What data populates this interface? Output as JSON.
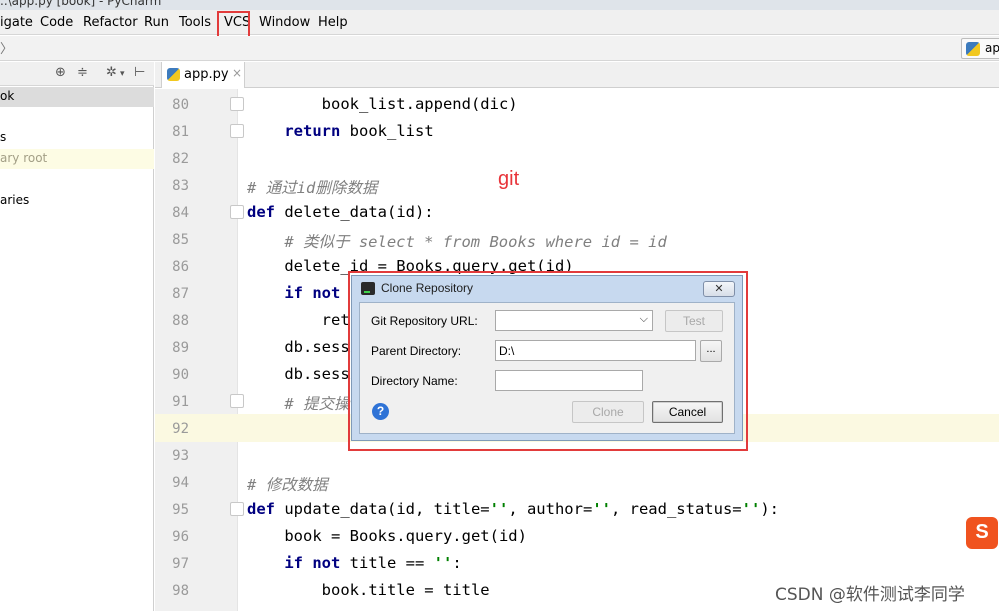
{
  "window": {
    "title": "..\\app.py [book] - PyCharm"
  },
  "menu": [
    "igate",
    "Code",
    "Refactor",
    "Run",
    "Tools",
    "VCS",
    "Window",
    "Help"
  ],
  "nav": {
    "run_config": "ap"
  },
  "project": {
    "rows": [
      "ok",
      "s",
      "ary root",
      "aries"
    ]
  },
  "editor": {
    "tab": "app.py",
    "lines": [
      {
        "n": "80",
        "text": "        book_list.append(dic)"
      },
      {
        "n": "81",
        "text": "    return book_list"
      },
      {
        "n": "82",
        "text": ""
      },
      {
        "n": "83",
        "text": "# 通过id删除数据"
      },
      {
        "n": "84",
        "text": "def delete_data(id):"
      },
      {
        "n": "85",
        "text": "    # 类似于 select * from Books where id = id"
      },
      {
        "n": "86",
        "text": "    delete_id = Books.query.get(id)"
      },
      {
        "n": "87",
        "text": "    if not"
      },
      {
        "n": "88",
        "text": "        ret"
      },
      {
        "n": "89",
        "text": "    db.sessi"
      },
      {
        "n": "90",
        "text": "    db.sessi"
      },
      {
        "n": "91",
        "text": "    # 提交操"
      },
      {
        "n": "92",
        "text": ""
      },
      {
        "n": "93",
        "text": ""
      },
      {
        "n": "94",
        "text": "# 修改数据"
      },
      {
        "n": "95",
        "text": "def update_data(id, title='', author='', read_status=''):"
      },
      {
        "n": "96",
        "text": "    book = Books.query.get(id)"
      },
      {
        "n": "97",
        "text": "    if not title == '':"
      },
      {
        "n": "98",
        "text": "        book.title = title"
      }
    ]
  },
  "annotation": {
    "git_label": "git"
  },
  "dialog": {
    "title": "Clone Repository",
    "close_glyph": "✕",
    "url_label": "Git Repository URL:",
    "url_value": "",
    "test_button": "Test",
    "parent_label": "Parent Directory:",
    "parent_value": "D:\\",
    "browse_button": "...",
    "name_label": "Directory Name:",
    "name_value": "",
    "clone_button": "Clone",
    "cancel_button": "Cancel",
    "help_glyph": "?"
  },
  "overlay": {
    "ime_badge": "S",
    "watermark": "CSDN @软件测试李同学"
  }
}
